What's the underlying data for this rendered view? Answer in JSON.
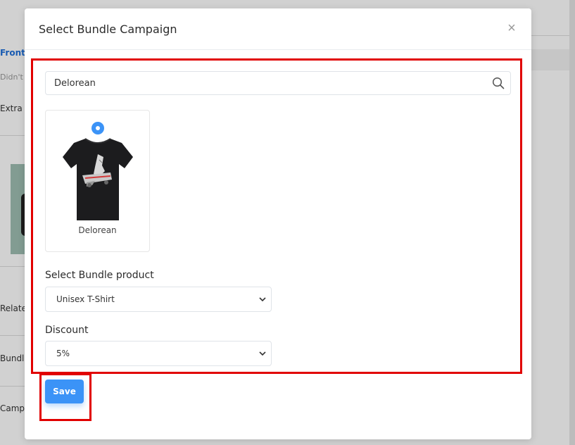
{
  "background": {
    "items": [
      {
        "label": "Front c",
        "kind": "link"
      },
      {
        "label": "Didn't s",
        "kind": "muted"
      },
      {
        "label": "Extra m",
        "kind": "text"
      },
      {
        "label": "Relate",
        "kind": "text"
      },
      {
        "label": "Bundle",
        "kind": "text"
      },
      {
        "label": "Camp",
        "kind": "text"
      }
    ]
  },
  "modal": {
    "title": "Select Bundle Campaign",
    "close_label": "×",
    "search": {
      "value": "Delorean",
      "placeholder": ""
    },
    "products": [
      {
        "name": "Delorean",
        "selected": true
      }
    ],
    "bundle_product": {
      "label": "Select Bundle product",
      "selected": "Unisex T-Shirt"
    },
    "discount": {
      "label": "Discount",
      "selected": "5%"
    },
    "save_label": "Save"
  },
  "colors": {
    "accent": "#3b93f7",
    "highlight": "#e10000"
  },
  "icons": {
    "search": "search-icon",
    "close": "close-icon",
    "chevron": "chevron-down-icon"
  }
}
